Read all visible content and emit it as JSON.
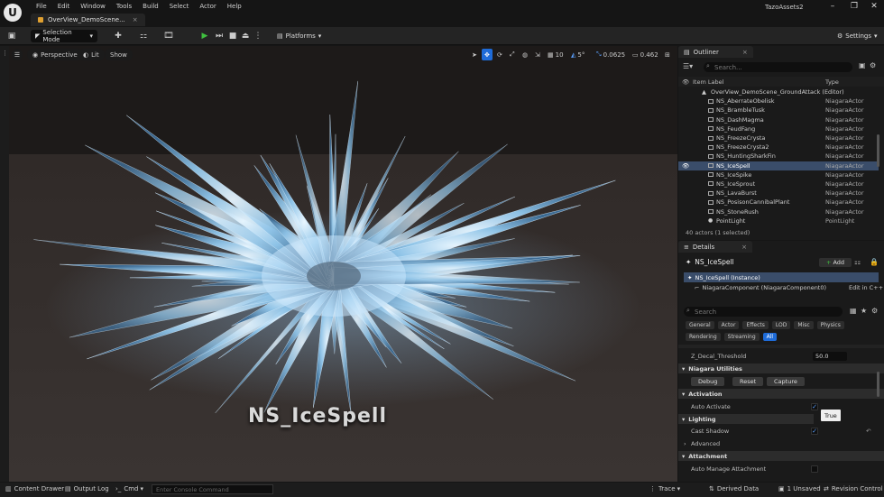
{
  "app": {
    "project_name": "TazoAssets2",
    "logo": "U"
  },
  "menu": [
    "File",
    "Edit",
    "Window",
    "Tools",
    "Build",
    "Select",
    "Actor",
    "Help"
  ],
  "document_tab": {
    "label": "OverView_DemoScene..."
  },
  "toolbar": {
    "selection_mode": "Selection Mode",
    "platforms": "Platforms",
    "settings": "Settings"
  },
  "viewport": {
    "perspective": "Perspective",
    "lit": "Lit",
    "show": "Show",
    "grid_value": "10",
    "angle_value": "5°",
    "scale_value": "0.0625",
    "camera_speed": "0.462",
    "world_text": "NS_IceSpell"
  },
  "outliner": {
    "tab_label": "Outliner",
    "search_placeholder": "Search...",
    "col_label": "Item Label",
    "col_type": "Type",
    "root": "OverView_DemoScene_GroundAttack (Editor)",
    "items": [
      {
        "name": "NS_AberrateObelisk",
        "type": "NiagaraActor",
        "selected": false
      },
      {
        "name": "NS_BrambleTusk",
        "type": "NiagaraActor",
        "selected": false
      },
      {
        "name": "NS_DashMagma",
        "type": "NiagaraActor",
        "selected": false
      },
      {
        "name": "NS_FeudFang",
        "type": "NiagaraActor",
        "selected": false
      },
      {
        "name": "NS_FreezeCrysta",
        "type": "NiagaraActor",
        "selected": false
      },
      {
        "name": "NS_FreezeCrysta2",
        "type": "NiagaraActor",
        "selected": false
      },
      {
        "name": "NS_HuntingSharkFin",
        "type": "NiagaraActor",
        "selected": false
      },
      {
        "name": "NS_IceSpell",
        "type": "NiagaraActor",
        "selected": true
      },
      {
        "name": "NS_IceSpike",
        "type": "NiagaraActor",
        "selected": false
      },
      {
        "name": "NS_IceSprout",
        "type": "NiagaraActor",
        "selected": false
      },
      {
        "name": "NS_LavaBurst",
        "type": "NiagaraActor",
        "selected": false
      },
      {
        "name": "NS_PosisonCannibalPlant",
        "type": "NiagaraActor",
        "selected": false
      },
      {
        "name": "NS_StoneRush",
        "type": "NiagaraActor",
        "selected": false
      },
      {
        "name": "PointLight",
        "type": "PointLight",
        "selected": false
      }
    ],
    "footer": "40 actors (1 selected)"
  },
  "details": {
    "tab_label": "Details",
    "actor_name": "NS_IceSpell",
    "add_label": "Add",
    "instance_label": "NS_IceSpell (Instance)",
    "component_label": "NiagaraComponent (NiagaraComponent0)",
    "edit_cpp": "Edit in C++",
    "search_placeholder": "Search",
    "categories_row1": [
      "General",
      "Actor",
      "Effects",
      "LOD",
      "Misc",
      "Physics"
    ],
    "categories_row2": [
      "Rendering",
      "Streaming",
      "All"
    ],
    "active_category": "All",
    "z_decal_label": "Z_Decal_Threshold",
    "z_decal_value": "50.0",
    "niagara_utilities": "Niagara Utilities",
    "debug_label": "Debug",
    "reset_label": "Reset",
    "capture_label": "Capture",
    "activation": "Activation",
    "auto_activate": "Auto Activate",
    "tooltip": "True",
    "lighting": "Lighting",
    "cast_shadow": "Cast Shadow",
    "advanced": "Advanced",
    "attachment": "Attachment",
    "auto_manage_attachment": "Auto Manage Attachment"
  },
  "statusbar": {
    "content_drawer": "Content Drawer",
    "output_log": "Output Log",
    "cmd": "Cmd",
    "console_placeholder": "Enter Console Command",
    "trace": "Trace",
    "derived_data": "Derived Data",
    "unsaved": "1 Unsaved",
    "revision_control": "Revision Control"
  },
  "colors": {
    "accent": "#1e6bd8",
    "selection": "#3a4d6a",
    "play_green": "#3fbf3f"
  }
}
